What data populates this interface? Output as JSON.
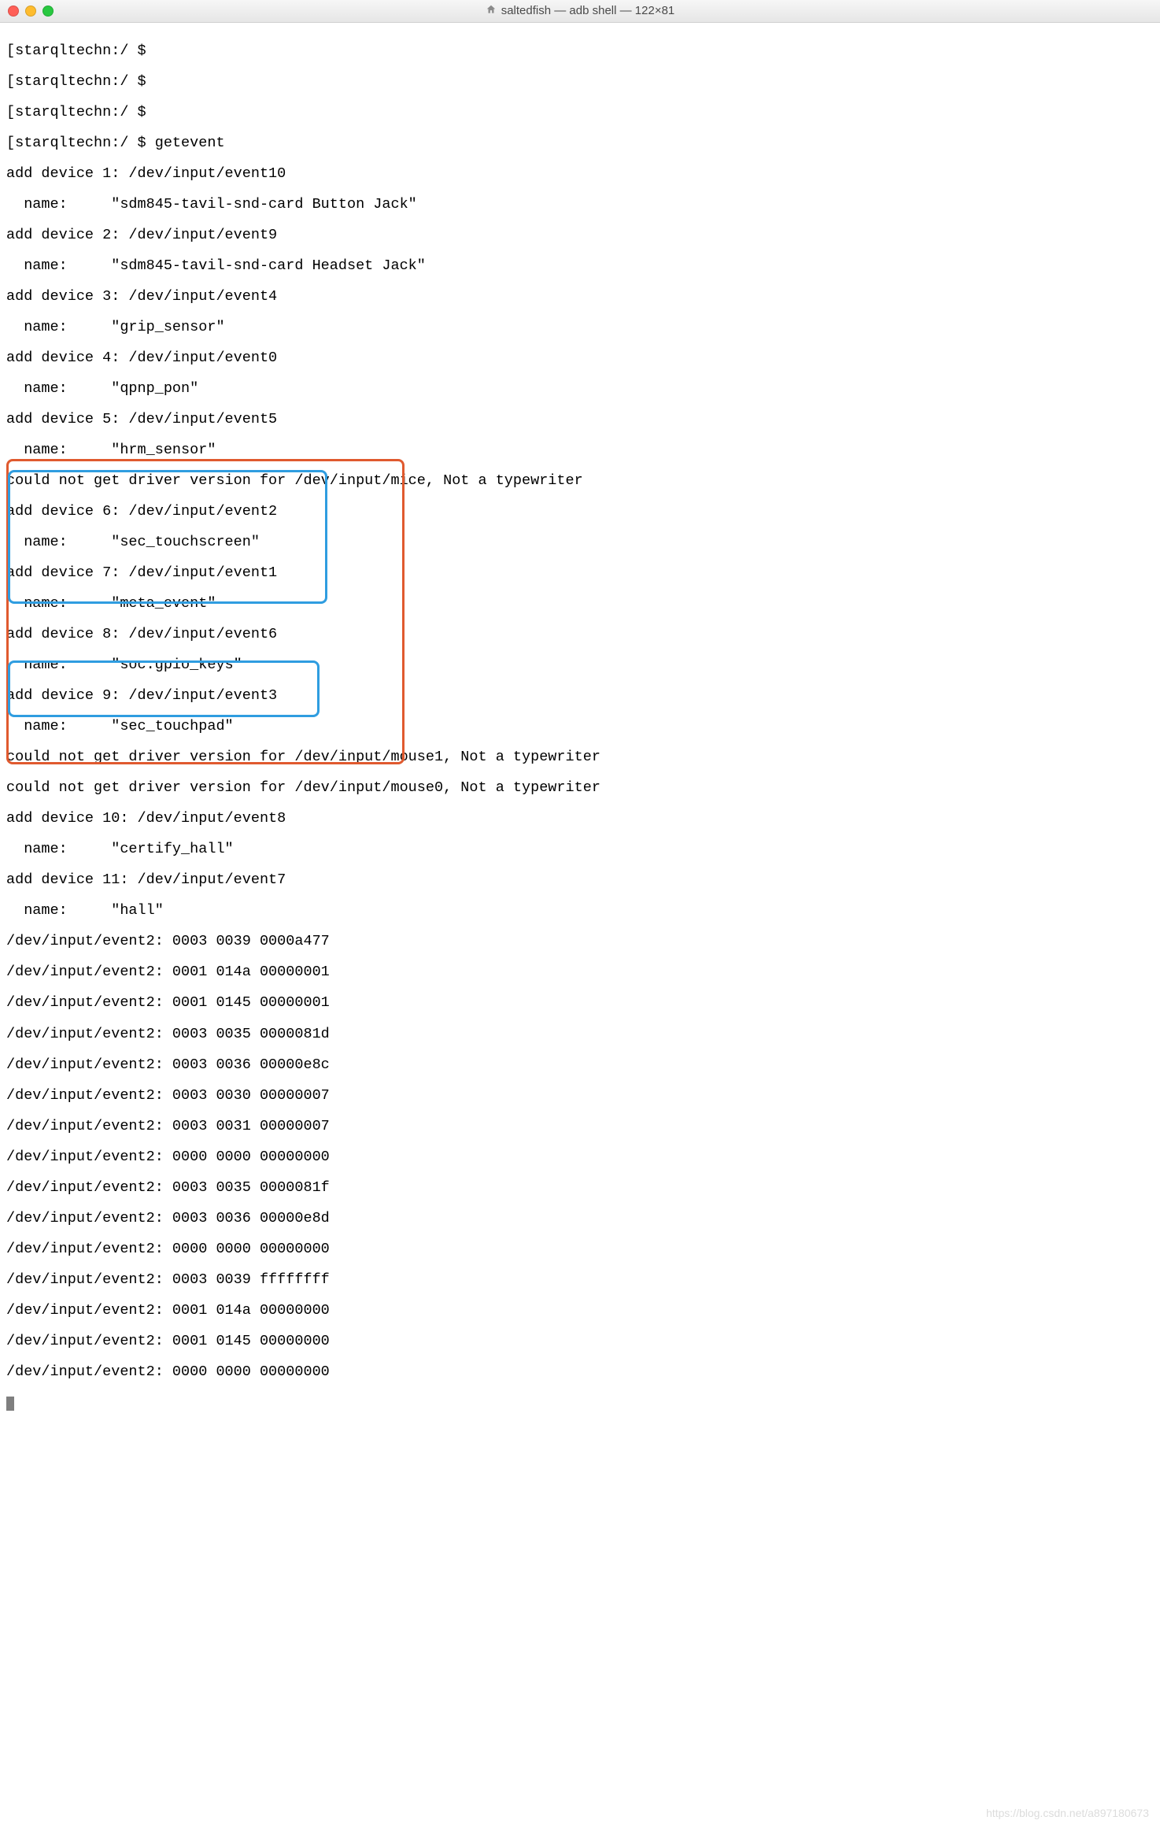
{
  "titlebar": {
    "title": "saltedfish — adb shell — 122×81",
    "icon": "home-icon"
  },
  "terminal": {
    "prompt": "starqltechn:/ $",
    "prompt_lines": [
      "[starqltechn:/ $",
      "[starqltechn:/ $",
      "[starqltechn:/ $",
      "[starqltechn:/ $ getevent"
    ],
    "device_lines": [
      "add device 1: /dev/input/event10",
      "  name:     \"sdm845-tavil-snd-card Button Jack\"",
      "add device 2: /dev/input/event9",
      "  name:     \"sdm845-tavil-snd-card Headset Jack\"",
      "add device 3: /dev/input/event4",
      "  name:     \"grip_sensor\"",
      "add device 4: /dev/input/event0",
      "  name:     \"qpnp_pon\"",
      "add device 5: /dev/input/event5",
      "  name:     \"hrm_sensor\"",
      "could not get driver version for /dev/input/mice, Not a typewriter",
      "add device 6: /dev/input/event2",
      "  name:     \"sec_touchscreen\"",
      "add device 7: /dev/input/event1",
      "  name:     \"meta_event\"",
      "add device 8: /dev/input/event6",
      "  name:     \"soc:gpio_keys\"",
      "add device 9: /dev/input/event3",
      "  name:     \"sec_touchpad\"",
      "could not get driver version for /dev/input/mouse1, Not a typewriter",
      "could not get driver version for /dev/input/mouse0, Not a typewriter",
      "add device 10: /dev/input/event8",
      "  name:     \"certify_hall\"",
      "add device 11: /dev/input/event7",
      "  name:     \"hall\""
    ],
    "event_lines": [
      "/dev/input/event2: 0003 0039 0000a477",
      "/dev/input/event2: 0001 014a 00000001",
      "/dev/input/event2: 0001 0145 00000001",
      "/dev/input/event2: 0003 0035 0000081d",
      "/dev/input/event2: 0003 0036 00000e8c",
      "/dev/input/event2: 0003 0030 00000007",
      "/dev/input/event2: 0003 0031 00000007",
      "/dev/input/event2: 0000 0000 00000000",
      "/dev/input/event2: 0003 0035 0000081f",
      "/dev/input/event2: 0003 0036 00000e8d",
      "/dev/input/event2: 0000 0000 00000000",
      "/dev/input/event2: 0003 0039 ffffffff",
      "/dev/input/event2: 0001 014a 00000000",
      "/dev/input/event2: 0001 0145 00000000",
      "/dev/input/event2: 0000 0000 00000000"
    ]
  },
  "watermark": "https://blog.csdn.net/a897180673"
}
